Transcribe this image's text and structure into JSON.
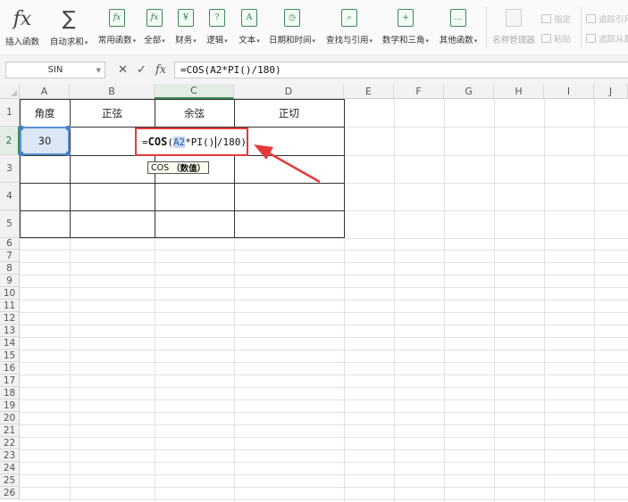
{
  "ribbon": {
    "items": [
      {
        "label": "插入函数",
        "icon": "fx-icon",
        "glyph": "fx",
        "caret": false
      },
      {
        "label": "自动求和",
        "icon": "sigma-icon",
        "glyph": "∑",
        "caret": true
      },
      {
        "label": "常用函数",
        "icon": "common-functions-icon",
        "glyph": "fx",
        "caret": true
      },
      {
        "label": "全部",
        "icon": "all-functions-icon",
        "glyph": "fx",
        "caret": true
      },
      {
        "label": "财务",
        "icon": "finance-icon",
        "glyph": "¥",
        "caret": true
      },
      {
        "label": "逻辑",
        "icon": "logic-icon",
        "glyph": "?",
        "caret": true
      },
      {
        "label": "文本",
        "icon": "text-icon",
        "glyph": "A",
        "caret": true
      },
      {
        "label": "日期和时间",
        "icon": "datetime-icon",
        "glyph": "◷",
        "caret": true
      },
      {
        "label": "查找与引用",
        "icon": "lookup-icon",
        "glyph": "⌕",
        "caret": true
      },
      {
        "label": "数学和三角",
        "icon": "math-icon",
        "glyph": "+",
        "caret": true
      },
      {
        "label": "其他函数",
        "icon": "other-functions-icon",
        "glyph": "…",
        "caret": true
      },
      {
        "label": "名称管理器",
        "icon": "name-manager-icon",
        "glyph": "",
        "caret": false
      }
    ],
    "small": {
      "define": "指定",
      "paste": "粘贴",
      "trace_precedents": "追踪引用",
      "trace_dependents": "追踪从属"
    }
  },
  "formula_bar": {
    "name_box": "SIN",
    "cancel": "✕",
    "confirm": "✓",
    "fx": "fx",
    "formula": "=COS(A2*PI()/180)"
  },
  "sheet": {
    "columns": [
      "A",
      "B",
      "C",
      "D",
      "E",
      "F",
      "G",
      "H",
      "I",
      "J"
    ],
    "rows": [
      "1",
      "2",
      "3",
      "4",
      "5",
      "6",
      "7",
      "8",
      "9",
      "10",
      "11",
      "12",
      "13",
      "14",
      "15",
      "16",
      "17",
      "18",
      "19",
      "20",
      "21",
      "22",
      "23",
      "24",
      "25",
      "26"
    ],
    "headers": {
      "a1": "角度",
      "b1": "正弦",
      "c1": "余弦",
      "d1": "正切"
    },
    "a2": "30",
    "edit": {
      "prefix": "=",
      "fn": "COS",
      "open": "(",
      "ref": "A2",
      "middle": "*PI()",
      "rest": "/180)"
    },
    "tooltip": {
      "fn": "COS",
      "arg": "（数值）"
    }
  },
  "colors": {
    "accent": "#3b8a55",
    "highlight": "#e53a3a",
    "selection": "#5b8fd6"
  }
}
